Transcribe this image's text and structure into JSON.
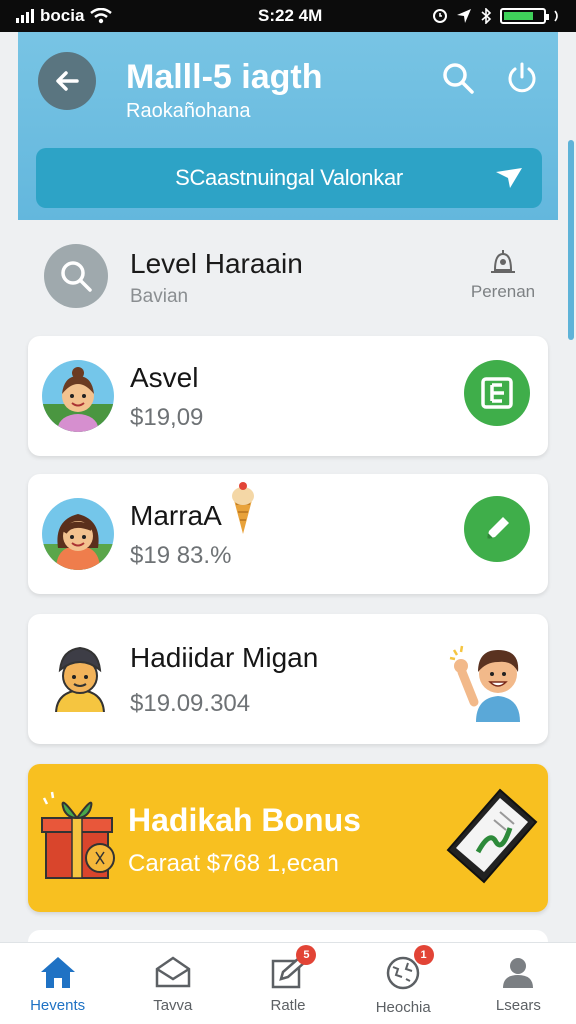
{
  "status_bar": {
    "carrier": "bocia",
    "time": "S:22 4M"
  },
  "header": {
    "title": "Malll-5 iagth",
    "subtitle": "Raokañohana",
    "search_text": "SCaastnuingal Valonkar",
    "icons": [
      "back-arrow-icon",
      "search-icon",
      "power-icon",
      "send-icon"
    ]
  },
  "level": {
    "title": "Level Haraain",
    "subtitle": "Bavian",
    "person_label": "Perenan"
  },
  "cards": [
    {
      "name": "Asvel",
      "amount": "$19,09",
      "action_icon": "b-icon"
    },
    {
      "name": "MarraA",
      "amount": "$19 83.%",
      "action_icon": "pencil-icon"
    },
    {
      "name": "Hadiidar Migan",
      "amount": "$19.09.304",
      "action_icon": ""
    }
  ],
  "bonus": {
    "title": "Hadikah Bonus",
    "subtitle": "Caraat $768 1,ecan"
  },
  "bottom_nav": [
    {
      "label": "Hevents",
      "icon": "home-icon",
      "active": true,
      "badge": ""
    },
    {
      "label": "Tavva",
      "icon": "mail-icon",
      "active": false,
      "badge": ""
    },
    {
      "label": "Ratle",
      "icon": "edit-icon",
      "active": false,
      "badge": "5"
    },
    {
      "label": "Heochia",
      "icon": "globe-icon",
      "active": false,
      "badge": "1"
    },
    {
      "label": "Lsears",
      "icon": "user-icon",
      "active": false,
      "badge": ""
    }
  ],
  "colors": {
    "header": "#6bbde0",
    "search_bar": "#2da3c6",
    "accent_green": "#3fae4a",
    "bonus": "#f8c020",
    "active_nav": "#1f72c4",
    "badge": "#e24436"
  }
}
